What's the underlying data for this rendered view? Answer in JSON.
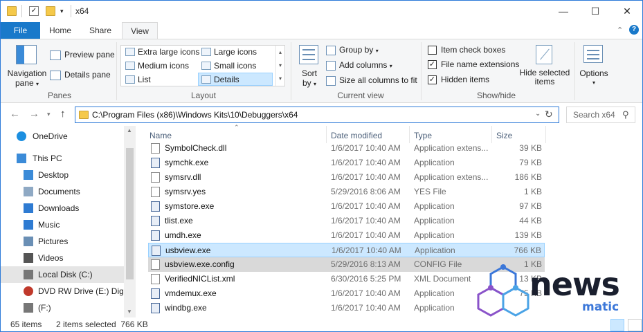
{
  "window": {
    "title": "x64",
    "controls": {
      "minimize": "—",
      "maximize": "☐",
      "close": "✕"
    }
  },
  "ribbon_tabs": [
    "File",
    "Home",
    "Share",
    "View"
  ],
  "ribbon": {
    "panes": {
      "group_label": "Panes",
      "navigation_pane_line1": "Navigation",
      "navigation_pane_line2": "pane",
      "preview_pane": "Preview pane",
      "details_pane": "Details pane"
    },
    "layout": {
      "group_label": "Layout",
      "items": [
        "Extra large icons",
        "Large icons",
        "Medium icons",
        "Small icons",
        "List",
        "Details"
      ],
      "selected": "Details"
    },
    "current_view": {
      "group_label": "Current view",
      "sort_line1": "Sort",
      "sort_line2": "by",
      "group_by": "Group by",
      "add_columns": "Add columns",
      "size_all_columns": "Size all columns to fit"
    },
    "show_hide": {
      "group_label": "Show/hide",
      "item_check_boxes": "Item check boxes",
      "file_name_extensions": "File name extensions",
      "hidden_items": "Hidden items",
      "item_check_boxes_checked": false,
      "file_name_extensions_checked": true,
      "hidden_items_checked": true,
      "hide_selected_line1": "Hide selected",
      "hide_selected_line2": "items"
    },
    "options": "Options"
  },
  "address": {
    "path": "C:\\Program Files (x86)\\Windows Kits\\10\\Debuggers\\x64",
    "search_placeholder": "Search x64"
  },
  "nav_pane": [
    {
      "label": "OneDrive",
      "icon": "cloud-icon"
    },
    {
      "label": "This PC",
      "icon": "computer-icon"
    },
    {
      "label": "Desktop",
      "icon": "desktop-icon"
    },
    {
      "label": "Documents",
      "icon": "documents-icon"
    },
    {
      "label": "Downloads",
      "icon": "downloads-icon"
    },
    {
      "label": "Music",
      "icon": "music-icon"
    },
    {
      "label": "Pictures",
      "icon": "pictures-icon"
    },
    {
      "label": "Videos",
      "icon": "videos-icon"
    },
    {
      "label": "Local Disk (C:)",
      "icon": "drive-icon"
    },
    {
      "label": "DVD RW Drive (E:) Digita",
      "icon": "dvd-icon"
    },
    {
      "label": "(F:)",
      "icon": "drive-icon"
    }
  ],
  "columns": {
    "name": "Name",
    "date": "Date modified",
    "type": "Type",
    "size": "Size"
  },
  "files": [
    {
      "name": "SymbolCheck.dll",
      "date": "1/6/2017 10:40 AM",
      "type": "Application extens...",
      "size": "39 KB"
    },
    {
      "name": "symchk.exe",
      "date": "1/6/2017 10:40 AM",
      "type": "Application",
      "size": "79 KB"
    },
    {
      "name": "symsrv.dll",
      "date": "1/6/2017 10:40 AM",
      "type": "Application extens...",
      "size": "186 KB"
    },
    {
      "name": "symsrv.yes",
      "date": "5/29/2016 8:06 AM",
      "type": "YES File",
      "size": "1 KB"
    },
    {
      "name": "symstore.exe",
      "date": "1/6/2017 10:40 AM",
      "type": "Application",
      "size": "97 KB"
    },
    {
      "name": "tlist.exe",
      "date": "1/6/2017 10:40 AM",
      "type": "Application",
      "size": "44 KB"
    },
    {
      "name": "umdh.exe",
      "date": "1/6/2017 10:40 AM",
      "type": "Application",
      "size": "139 KB"
    },
    {
      "name": "usbview.exe",
      "date": "1/6/2017 10:40 AM",
      "type": "Application",
      "size": "766 KB"
    },
    {
      "name": "usbview.exe.config",
      "date": "5/29/2016 8:13 AM",
      "type": "CONFIG File",
      "size": "1 KB"
    },
    {
      "name": "VerifiedNICList.xml",
      "date": "6/30/2016 5:25 PM",
      "type": "XML Document",
      "size": "13 KB"
    },
    {
      "name": "vmdemux.exe",
      "date": "1/6/2017 10:40 AM",
      "type": "Application",
      "size": "75 KB"
    },
    {
      "name": "windbg.exe",
      "date": "1/6/2017 10:40 AM",
      "type": "Application",
      "size": ""
    }
  ],
  "status": {
    "count": "65 items",
    "selected": "2 items selected  766 KB"
  },
  "watermark": {
    "line1": "news",
    "line2": "matic"
  },
  "colors": {
    "accent": "#1979ca",
    "selection": "#cce8ff",
    "selection_border": "#99d1ff",
    "window_border": "#2b79d8"
  }
}
